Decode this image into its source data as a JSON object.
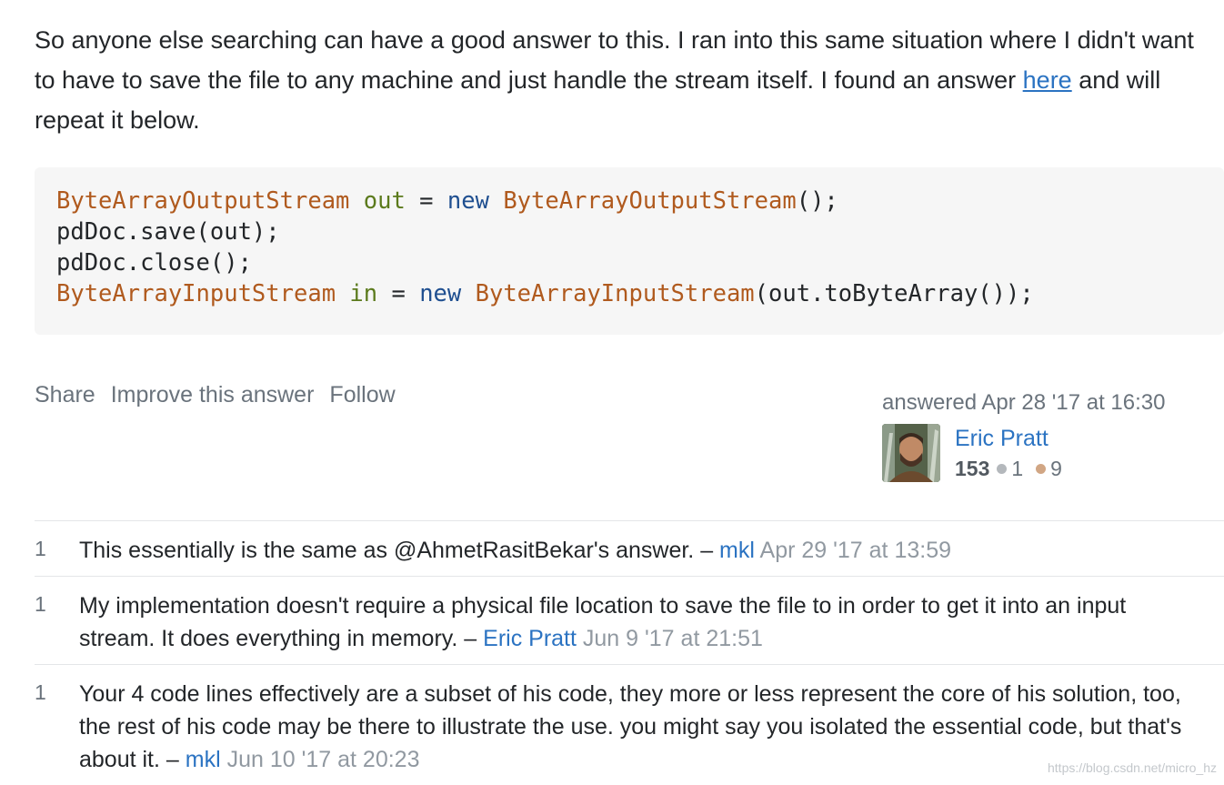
{
  "answer": {
    "text_before_link": "So anyone else searching can have a good answer to this. I ran into this same situation where I didn't want to have to save the file to any machine and just handle the stream itself. I found an answer ",
    "link_text": "here",
    "text_after_link": " and will repeat it below."
  },
  "code": {
    "lines": [
      [
        {
          "t": "ByteArrayOutputStream",
          "c": "type"
        },
        {
          "t": " "
        },
        {
          "t": "out",
          "c": "var"
        },
        {
          "t": " = "
        },
        {
          "t": "new",
          "c": "kw"
        },
        {
          "t": " "
        },
        {
          "t": "ByteArrayOutputStream",
          "c": "type"
        },
        {
          "t": "();"
        }
      ],
      [
        {
          "t": "pdDoc.save(out);"
        }
      ],
      [
        {
          "t": "pdDoc.close();"
        }
      ],
      [
        {
          "t": "ByteArrayInputStream",
          "c": "type"
        },
        {
          "t": " "
        },
        {
          "t": "in",
          "c": "var"
        },
        {
          "t": " = "
        },
        {
          "t": "new",
          "c": "kw"
        },
        {
          "t": " "
        },
        {
          "t": "ByteArrayInputStream",
          "c": "type"
        },
        {
          "t": "(out.toByteArray());"
        }
      ]
    ]
  },
  "menu": {
    "share": "Share",
    "improve": "Improve this answer",
    "follow": "Follow"
  },
  "signature": {
    "action": "answered Apr 28 '17 at 16:30",
    "user_name": "Eric Pratt",
    "reputation": "153",
    "silver_badges": "1",
    "bronze_badges": "9"
  },
  "comments": [
    {
      "score": "1",
      "text": "This essentially is the same as @AhmetRasitBekar's answer.",
      "user": "mkl",
      "date": "Apr 29 '17 at 13:59"
    },
    {
      "score": "1",
      "text": "My implementation doesn't require a physical file location to save the file to in order to get it into an input stream. It does everything in memory.",
      "user": "Eric Pratt",
      "date": "Jun 9 '17 at 21:51"
    },
    {
      "score": "1",
      "text": "Your 4 code lines effectively are a subset of his code, they more or less represent the core of his solution, too, the rest of his code may be there to illustrate the use. you might say you isolated the essential code, but that's about it.",
      "user": "mkl",
      "date": "Jun 10 '17 at 20:23"
    }
  ],
  "watermark": "https://blog.csdn.net/micro_hz",
  "colors": {
    "link": "#2b73c2",
    "code_type": "#b05a1e",
    "code_var": "#5b7a1c",
    "code_keyword": "#1f4f90",
    "code_bg": "#f6f6f6",
    "muted": "#6a737c"
  }
}
